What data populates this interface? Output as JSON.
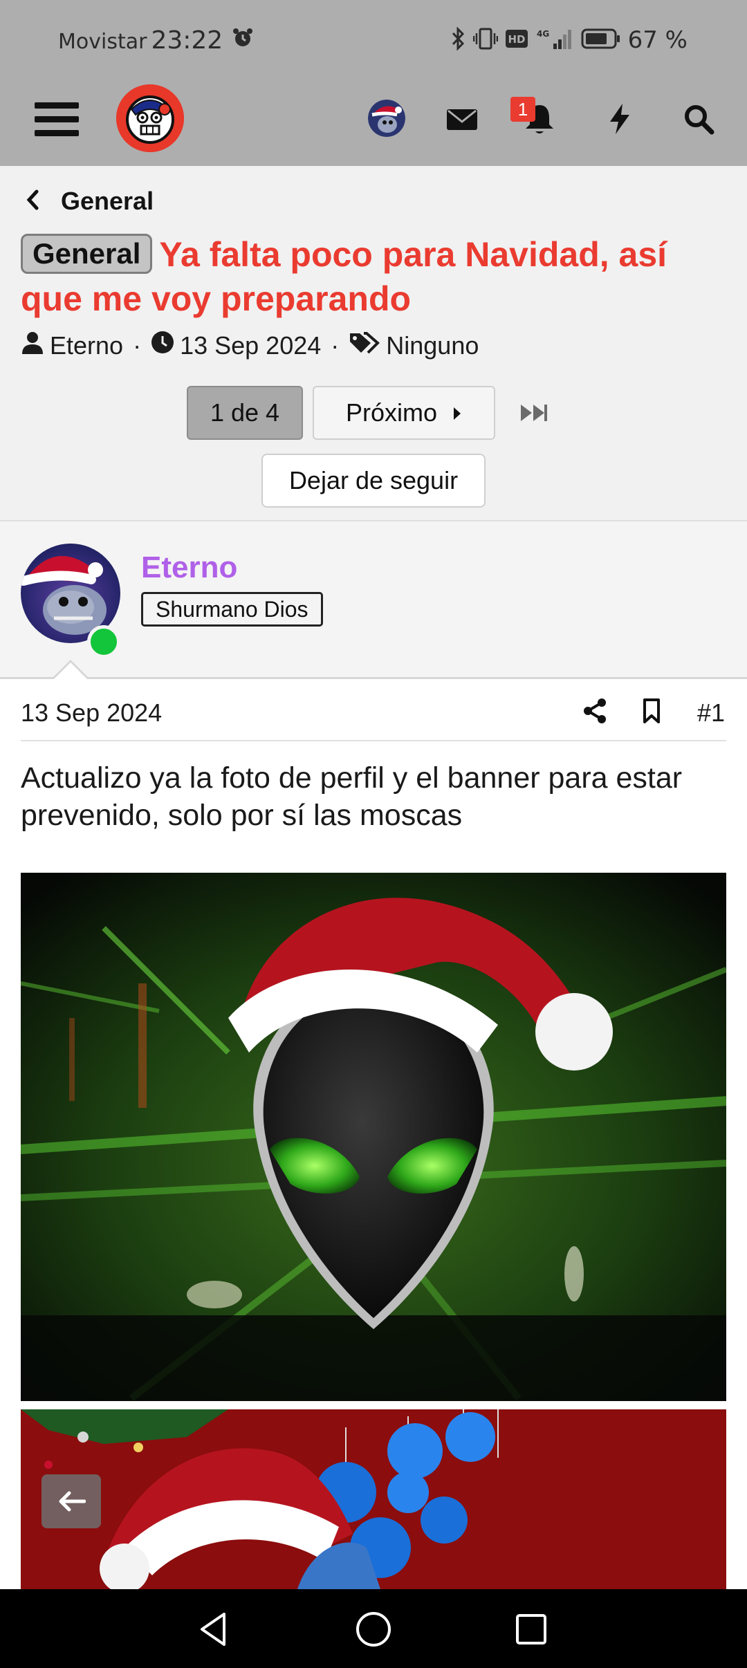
{
  "status_bar": {
    "carrier": "Movistar",
    "time": "23:22",
    "network": "4G",
    "battery": "67 %"
  },
  "top_nav": {
    "notifications_count": "1",
    "icons": [
      "menu-icon",
      "site-logo",
      "user-avatar",
      "envelope-icon",
      "bell-icon",
      "bolt-icon",
      "search-icon"
    ]
  },
  "breadcrumb": {
    "label": "General"
  },
  "thread": {
    "prefix": "General",
    "title": "Ya falta poco para Navidad, así que me voy preparando",
    "author": "Eterno",
    "date": "13 Sep 2024",
    "tags": "Ninguno",
    "accent_color": "#ea3b30"
  },
  "pagination": {
    "current": "1 de 4",
    "next_label": "Próximo"
  },
  "unfollow_label": "Dejar de seguir",
  "post": {
    "username": "Eterno",
    "username_color": "#b060e8",
    "user_title": "Shurmano Dios",
    "online_color": "#13c53a",
    "date": "13 Sep 2024",
    "number": "#1",
    "body": "Actualizo ya la foto de perfil y el banner para estar prevenido, solo por sí las moscas"
  }
}
